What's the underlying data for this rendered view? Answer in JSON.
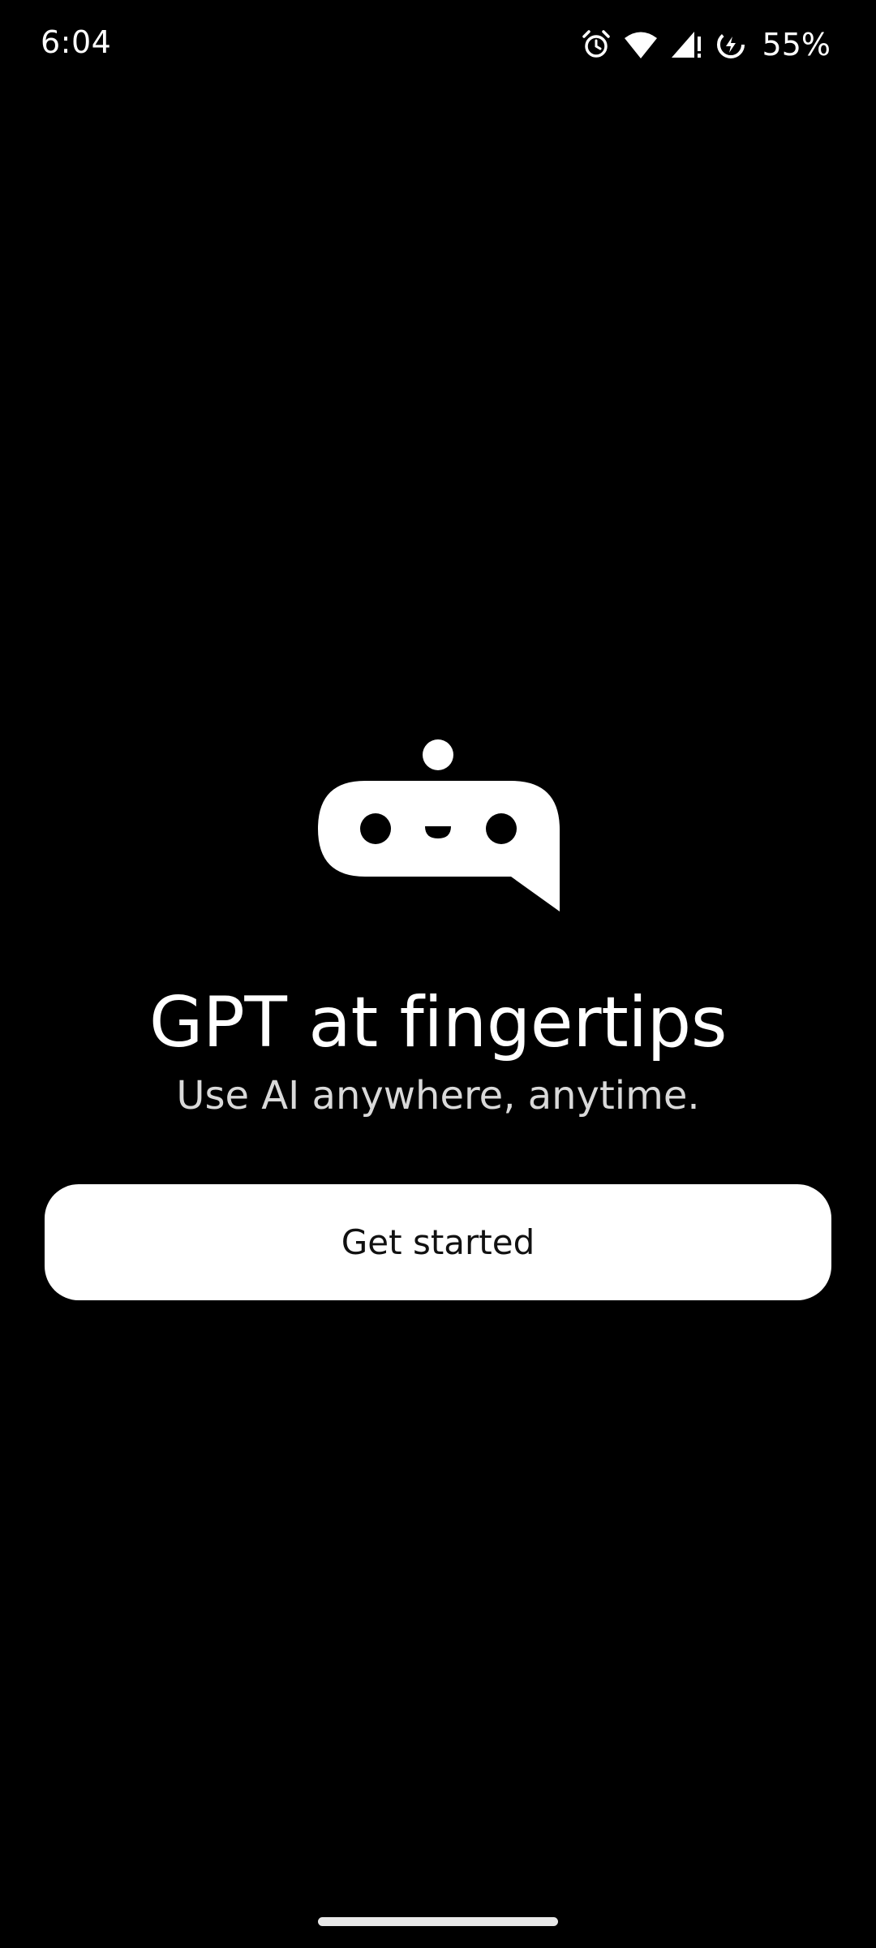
{
  "status_bar": {
    "time": "6:04",
    "battery_percent": "55%",
    "icons": [
      "alarm-icon",
      "wifi-icon",
      "cell-signal-icon",
      "battery-charging-icon"
    ]
  },
  "logo": {
    "icon": "chatbot-bubble-icon"
  },
  "main": {
    "title": "GPT at fingertips",
    "subtitle": "Use AI anywhere, anytime.",
    "cta_label": "Get started"
  },
  "colors": {
    "background": "#000000",
    "foreground": "#ffffff",
    "button_text": "#111111"
  }
}
